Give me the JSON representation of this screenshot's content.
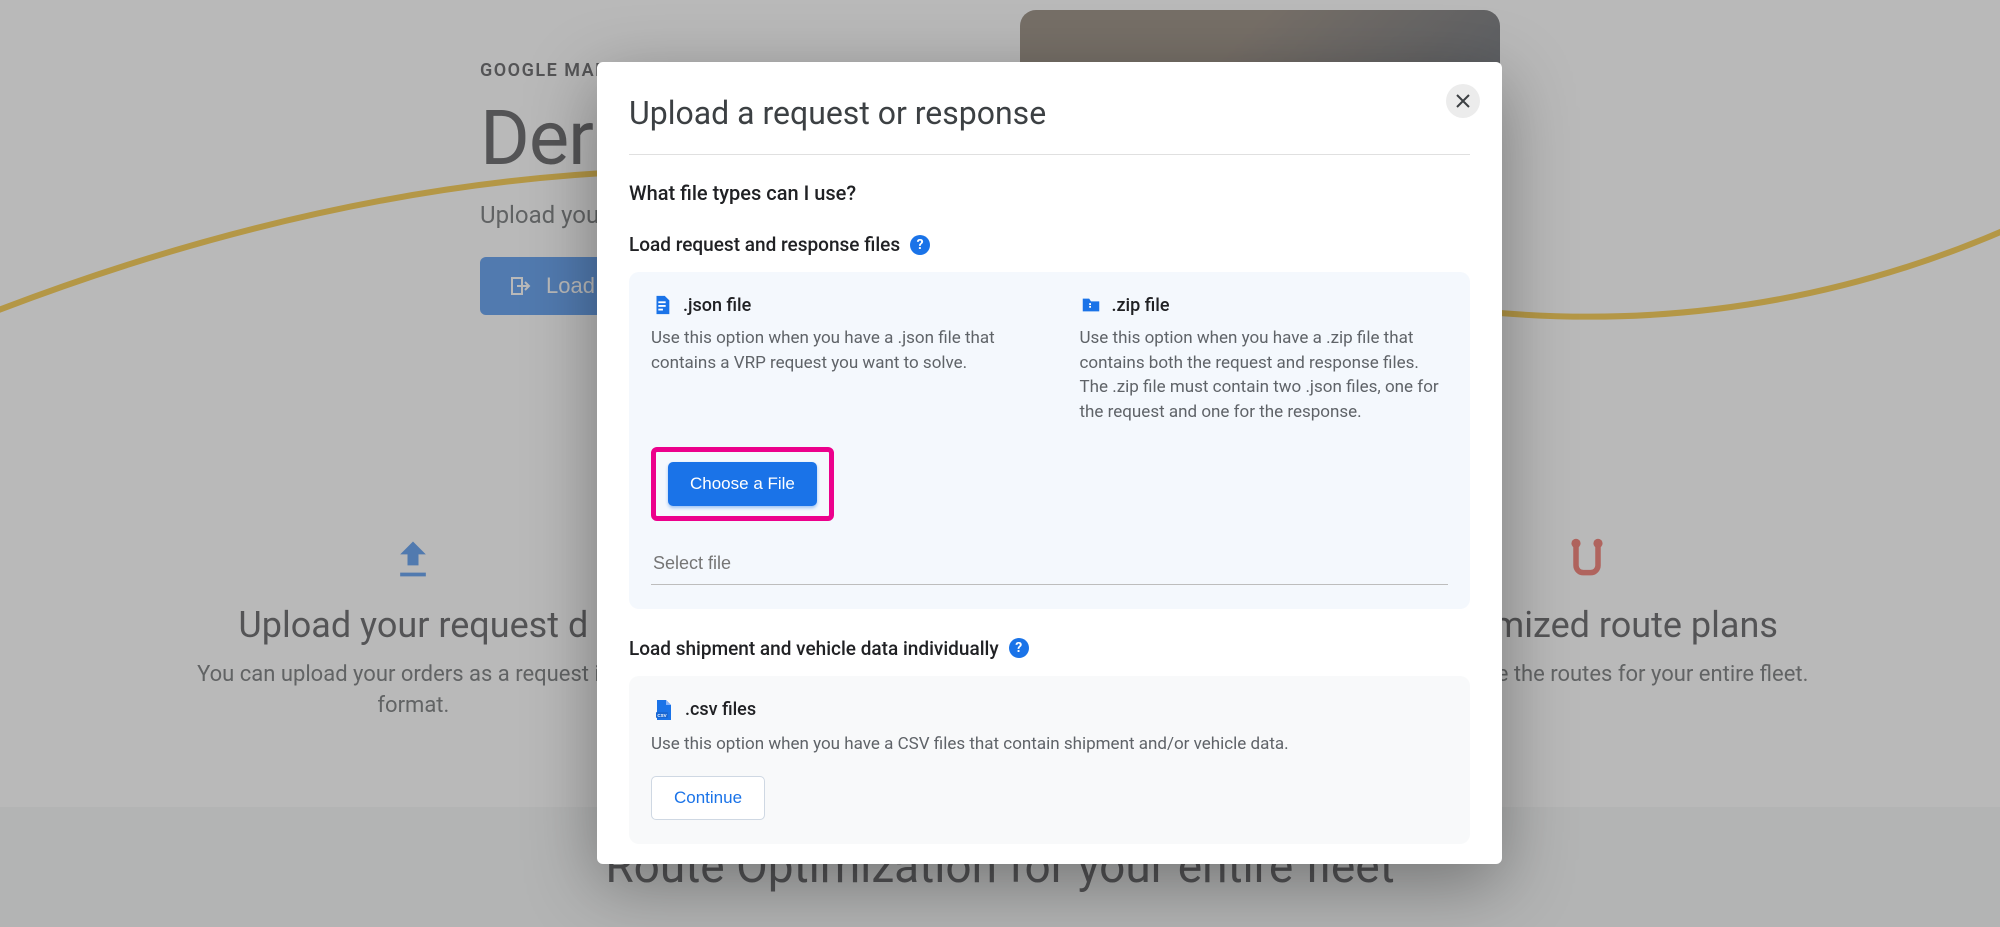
{
  "hero": {
    "eyebrow": "GOOGLE MAPS",
    "title": "Der",
    "subtitle": "Upload you",
    "loadBtn": "Load."
  },
  "steps": {
    "upload": {
      "title": "Upload your request d",
      "desc1": "You can upload your orders as a request in J",
      "desc2": "format."
    },
    "view": {
      "title": "w optimized route plans",
      "desc": "e and simulate the routes for your entire fleet."
    }
  },
  "bottom": {
    "title": "Route Optimization for your entire fleet"
  },
  "modal": {
    "title": "Upload a request or response",
    "q1": "What file types can I use?",
    "section1Label": "Load request and response files",
    "json": {
      "label": ".json file",
      "desc": "Use this option when you have a .json file that contains a VRP request you want to solve."
    },
    "zip": {
      "label": ".zip file",
      "desc": "Use this option when you have a .zip file that contains both the request and response files. The .zip file must contain two .json files, one for the request and one for the response."
    },
    "chooseBtn": "Choose a File",
    "filePlaceholder": "Select file",
    "section2Label": "Load shipment and vehicle data individually",
    "csv": {
      "label": ".csv files",
      "desc": "Use this option when you have a CSV files that contain shipment and/or vehicle data."
    },
    "continueBtn": "Continue"
  }
}
